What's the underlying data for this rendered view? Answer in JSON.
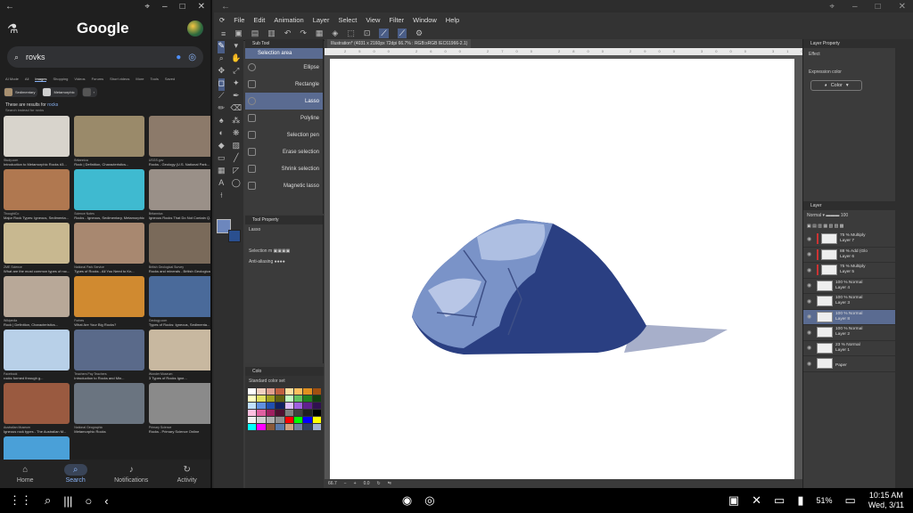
{
  "google": {
    "title": "Google",
    "search_value": "rovks",
    "tabs": [
      "AI Mode",
      "All",
      "Images",
      "Shopping",
      "Videos",
      "Forums",
      "Short videos",
      "More",
      "Tools",
      "Saved"
    ],
    "chips": [
      "Sedimentary",
      "Metamorphic"
    ],
    "results_note": "These are results for",
    "results_query": "rocks",
    "instead_note": "Search instead for rovks",
    "images": [
      {
        "src": "Study.com",
        "title": "Introduction to Metamorphic Rocks #3...",
        "color": "#d8d4cc"
      },
      {
        "src": "Britannica",
        "title": "Rock | Definition, Characteristics...",
        "color": "#9a8a6a"
      },
      {
        "src": "USGS.gov",
        "title": "Rocks - Geology (U.S. National Park...",
        "color": "#8c7a6a"
      },
      {
        "src": "ThoughtCo",
        "title": "Major Rock Types: Igneous, Sedimenta...",
        "color": "#b07850"
      },
      {
        "src": "Science Notes",
        "title": "Rocks - Igneous, Sedimentary, Metamorphic",
        "color": "#3fbad0"
      },
      {
        "src": "Britannica",
        "title": "Igneous Rocks That Do Not Contain Q...",
        "color": "#9a9088"
      },
      {
        "src": "ZME Science",
        "title": "What are the most common types of roc...",
        "color": "#c8b890"
      },
      {
        "src": "National Park Service",
        "title": "Types of Rocks - All You Need to Kn...",
        "color": "#a88870"
      },
      {
        "src": "British Geological Survey",
        "title": "Rocks and minerals - British Geological...",
        "color": "#7a6a5a"
      },
      {
        "src": "Wikipedia",
        "title": "Rock | Definition, Characteristics...",
        "color": "#b8a898"
      },
      {
        "src": "Forbes",
        "title": "What Are Your Big Rocks?",
        "color": "#d08a30"
      },
      {
        "src": "Geology.com",
        "title": "Types of Rocks: Igneous, Sedimenta...",
        "color": "#4a6a9a"
      },
      {
        "src": "Facebook",
        "title": "rocks formed through g...",
        "color": "#b8d0e8"
      },
      {
        "src": "Teachers Pay Teachers",
        "title": "Introduction to Rocks and Min...",
        "color": "#5a6a8a"
      },
      {
        "src": "Wonder Museum",
        "title": "3 Types of Rocks Igne...",
        "color": "#c8b8a0"
      },
      {
        "src": "Australian Museum",
        "title": "Igneous rock types - The Australian M...",
        "color": "#9a5a40"
      },
      {
        "src": "National Geographic",
        "title": "Metamorphic Rocks",
        "color": "#6a7480"
      },
      {
        "src": "Primary Science",
        "title": "Rocks - Primary Science Online",
        "color": "#8a8a8a"
      },
      {
        "src": "Sedimentary Rocks",
        "title": "Sedimentary Rocks",
        "color": "#4aa0d8"
      }
    ],
    "nav": [
      {
        "label": "Home",
        "icon": "⌂"
      },
      {
        "label": "Search",
        "icon": "⌕"
      },
      {
        "label": "Notifications",
        "icon": "♪"
      },
      {
        "label": "Activity",
        "icon": "↻"
      }
    ]
  },
  "csp": {
    "menu": [
      "File",
      "Edit",
      "Animation",
      "Layer",
      "Select",
      "View",
      "Filter",
      "Window",
      "Help"
    ],
    "subtool_title": "Sub Tool",
    "subtools": [
      "Selection area",
      "Ellipse",
      "Rectangle",
      "Lasso",
      "Polyline",
      "Selection pen",
      "Erase selection",
      "Shrink selection",
      "Magnetic lasso"
    ],
    "toolprop_title": "Tool Property",
    "toolprop_name": "Lasso",
    "selection_label": "Selection m",
    "antialias_label": "Anti-aliasing",
    "colorset_title": "Colo",
    "colorset_name": "Standard color set",
    "doc_tab": "Illustration* (4031 x 2160px 72dpi 66.7% : RGB:sRGB IEC61966-2.1)",
    "zoom": "66.7",
    "angle": "0.0",
    "layer_property_title": "Layer Property",
    "effect_label": "Effect",
    "expression_color_label": "Expression color",
    "expression_color_value": "Color",
    "layer_panel_title": "Layer",
    "blend_mode": "Normal",
    "opacity": "100",
    "layers": [
      {
        "mode": "75 % Multiply",
        "name": "Layer 7"
      },
      {
        "mode": "88 % Add (Glo",
        "name": "Layer 6"
      },
      {
        "mode": "75 % Multiply",
        "name": "Layer 5"
      },
      {
        "mode": "100 % Normal",
        "name": "Layer 4"
      },
      {
        "mode": "100 % Normal",
        "name": "Layer 3"
      },
      {
        "mode": "100 % Normal",
        "name": "Layer 8"
      },
      {
        "mode": "100 % Normal",
        "name": "Layer 2"
      },
      {
        "mode": "23 % Normal",
        "name": "Layer 1"
      },
      {
        "mode": "",
        "name": "Paper"
      }
    ]
  },
  "status": {
    "time": "10:15 AM",
    "date": "Wed, 3/11",
    "battery": "51%"
  }
}
